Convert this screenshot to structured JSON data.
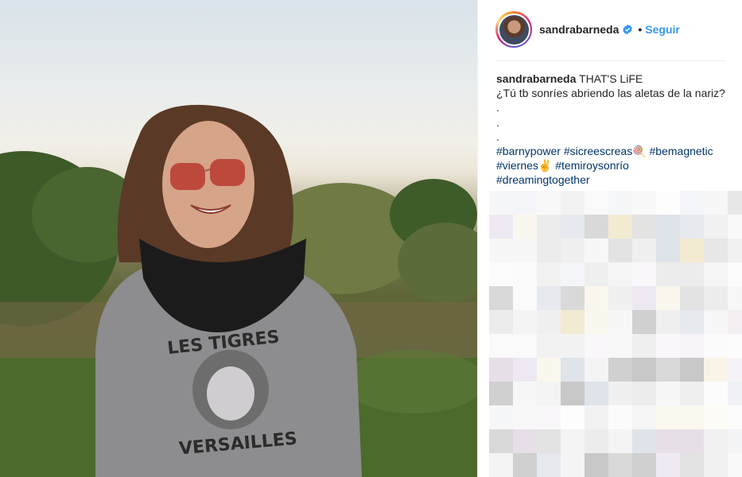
{
  "post": {
    "username": "sandrabarneda",
    "follow_label": "Seguir",
    "separator": "•",
    "caption": {
      "user": "sandrabarneda",
      "title": "THAT'S LiFE",
      "text": "¿Tú tb sonríes abriendo las aletas de la nariz? .",
      "dot1": ".",
      "dot2": ".",
      "hashtags_line1": [
        "#barnypower",
        "#sicreescreas🍭",
        "#bemagnetic"
      ],
      "hashtags_line2": [
        "#viernes✌",
        "#temiroysonrío"
      ],
      "hashtags_line3": [
        "#dreamingtogether"
      ]
    }
  },
  "photo": {
    "sweatshirt_text_top": "LES TIGRES",
    "sweatshirt_text_bottom": "VERSAILLES"
  },
  "colors": {
    "link_blue": "#3897f0",
    "hashtag": "#003569",
    "verified": "#3897f0"
  }
}
